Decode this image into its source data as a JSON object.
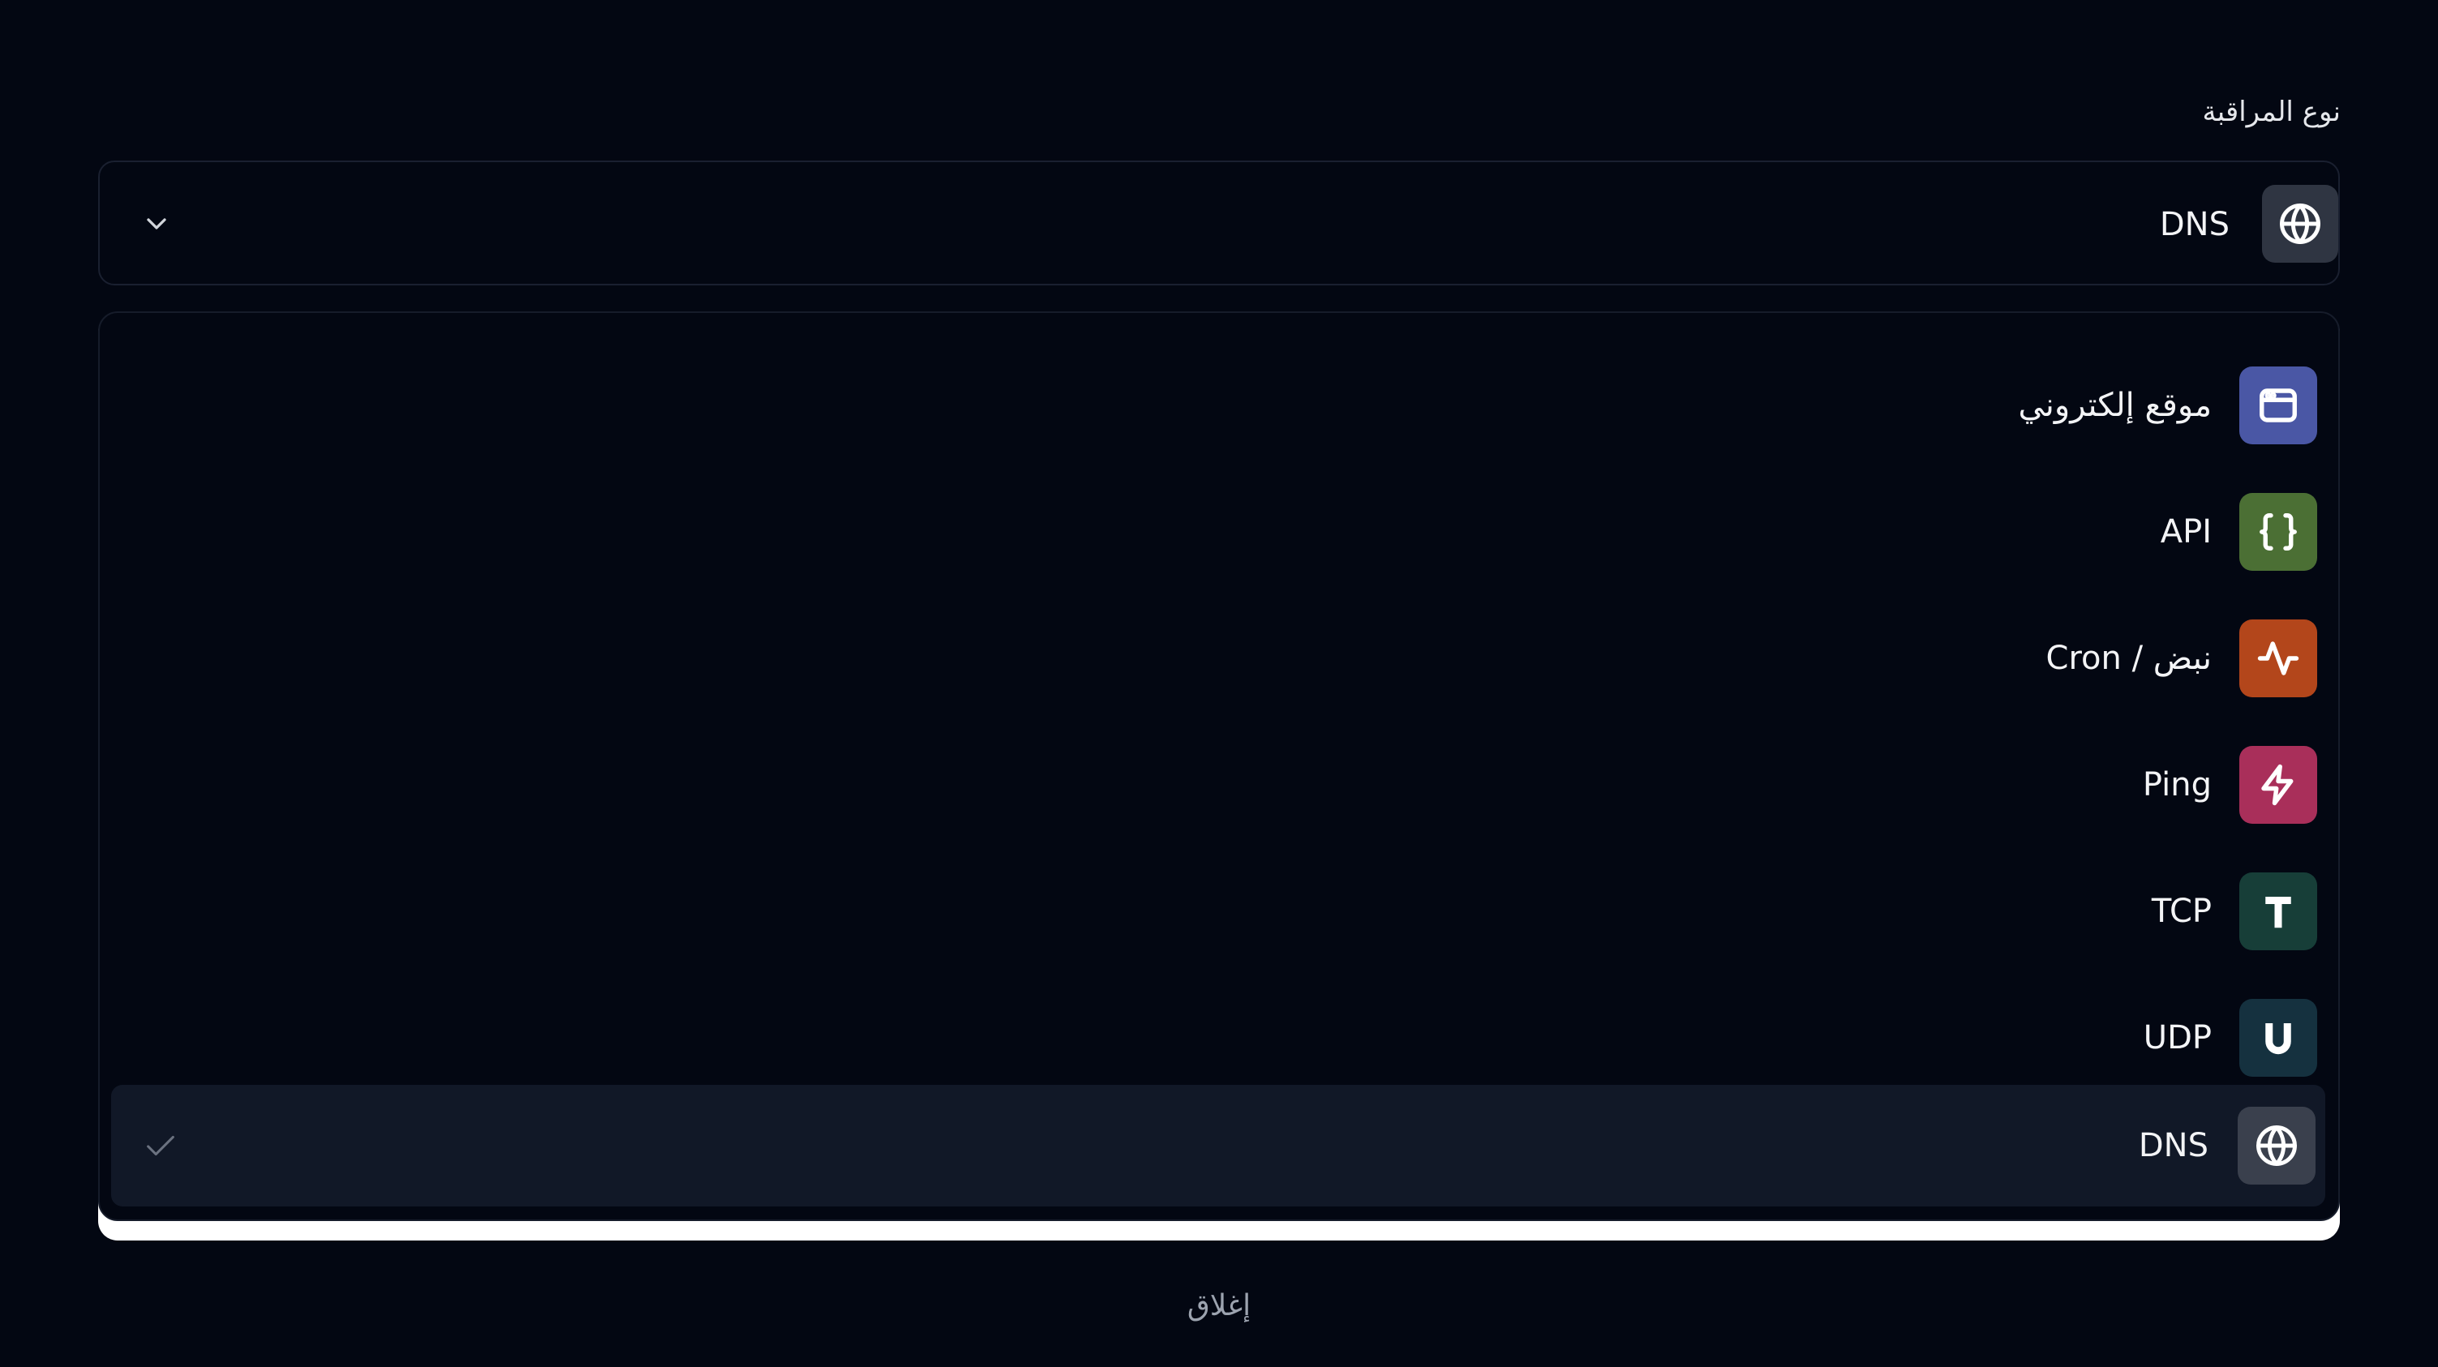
{
  "field": {
    "label": "نوع المراقبة"
  },
  "select": {
    "selected_label": "DNS",
    "selected_icon": "globe-icon"
  },
  "options": [
    {
      "label": "موقع إلكتروني",
      "icon": "browser-window-icon",
      "color": "#4a57a5"
    },
    {
      "label": "API",
      "icon": "braces-icon",
      "color": "#4b6f34"
    },
    {
      "label": "Cron / نبض",
      "icon": "pulse-icon",
      "color": "#b3461b"
    },
    {
      "label": "Ping",
      "icon": "lightning-icon",
      "color": "#a92f5a"
    },
    {
      "label": "TCP",
      "icon": "letter-t-icon",
      "color": "#173e38"
    },
    {
      "label": "UDP",
      "icon": "letter-u-icon",
      "color": "#15313f"
    },
    {
      "label": "DNS",
      "icon": "globe-icon",
      "color": "#3a404d",
      "selected": true
    }
  ],
  "footer": {
    "close_label": "إغلاق"
  },
  "colors": {
    "background": "#030712",
    "selected_row": "#111827"
  }
}
